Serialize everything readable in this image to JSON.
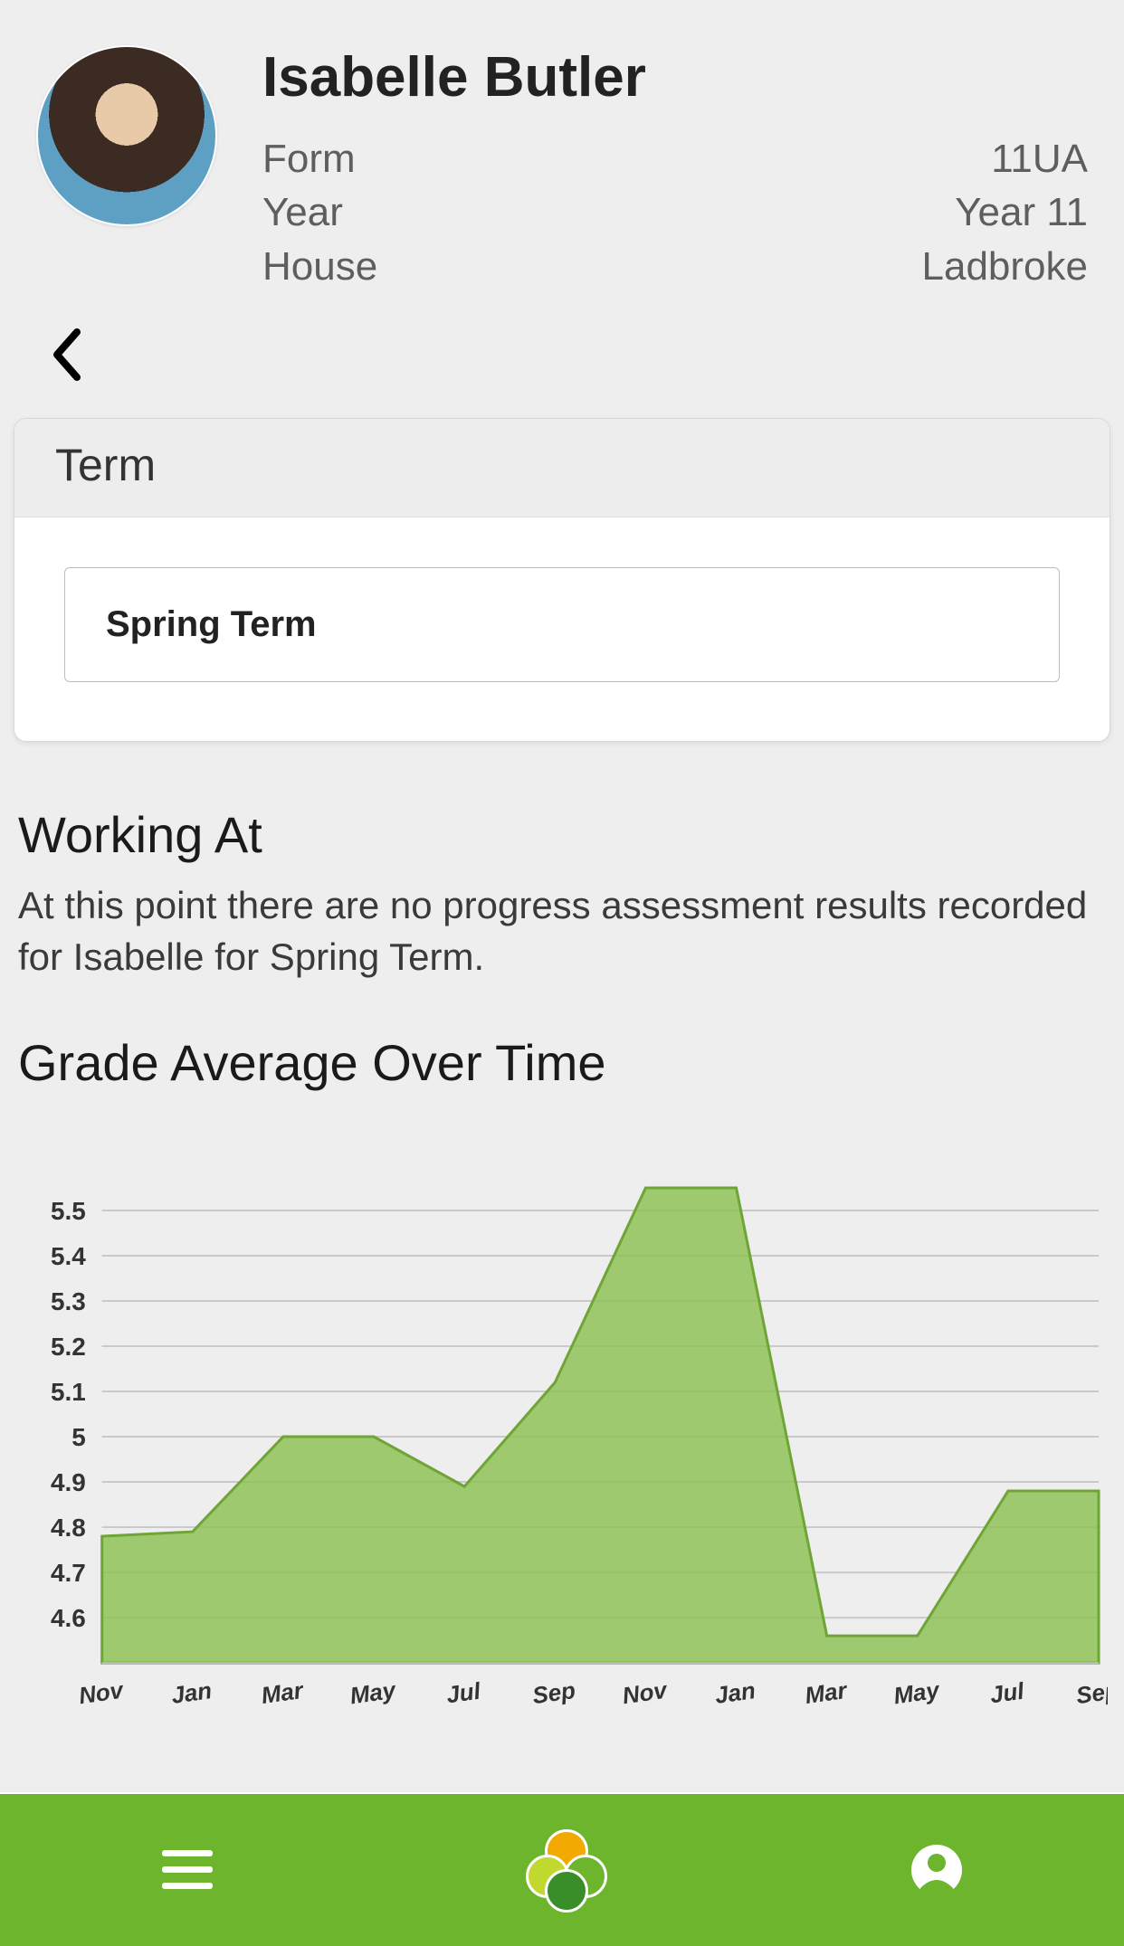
{
  "student": {
    "name": "Isabelle Butler",
    "fields": {
      "form_label": "Form",
      "form_value": "11UA",
      "year_label": "Year",
      "year_value": "Year 11",
      "house_label": "House",
      "house_value": "Ladbroke"
    }
  },
  "term_card": {
    "header": "Term",
    "selected": "Spring Term"
  },
  "working_at": {
    "heading": "Working At",
    "message": "At this point there are no progress assessment results recorded for Isabelle for Spring Term."
  },
  "chart_heading": "Grade Average Over Time",
  "chart_data": {
    "type": "area",
    "title": "Grade Average Over Time",
    "xlabel": "",
    "ylabel": "",
    "ylim": [
      4.5,
      5.6
    ],
    "yticks": [
      4.6,
      4.7,
      4.8,
      4.9,
      5.0,
      5.1,
      5.2,
      5.3,
      5.4,
      5.5
    ],
    "categories": [
      "Nov",
      "Jan",
      "Mar",
      "May",
      "Jul",
      "Sep",
      "Nov",
      "Jan",
      "Mar",
      "May",
      "Jul",
      "Sep"
    ],
    "values": [
      4.78,
      4.79,
      5.0,
      5.0,
      4.89,
      5.12,
      5.55,
      5.55,
      4.56,
      4.56,
      4.88,
      4.88
    ],
    "fill_color": "#8cc152"
  },
  "nav": {
    "menu": "menu",
    "home": "home",
    "profile": "profile"
  }
}
